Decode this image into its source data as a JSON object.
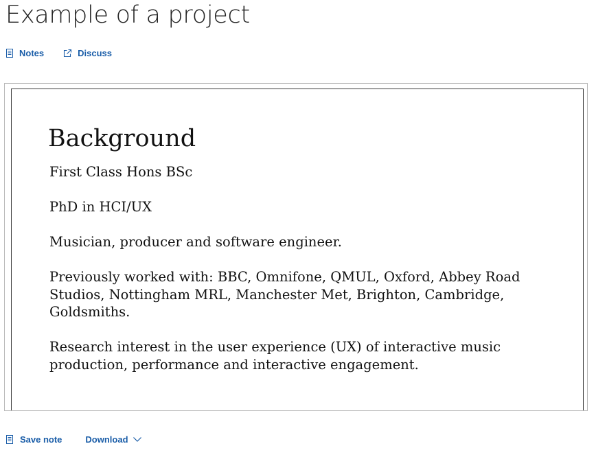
{
  "page": {
    "title": "Example of a project"
  },
  "top_links": {
    "notes_label": "Notes",
    "discuss_label": "Discuss"
  },
  "slide": {
    "heading": "Background",
    "paragraphs": [
      "First Class Hons BSc",
      "PhD in HCI/UX",
      "Musician, producer and software engineer.",
      "Previously worked with: BBC, Omnifone, QMUL, Oxford, Abbey Road Studios, Nottingham MRL, Manchester Met, Brighton, Cambridge, Goldsmiths.",
      "Research interest in the user experience (UX) of interactive music production, performance and interactive engagement."
    ]
  },
  "bottom_bar": {
    "save_note_label": "Save note",
    "download_label": "Download"
  },
  "icons": {
    "notes": "notes-document-icon",
    "discuss": "external-link-icon",
    "save_note": "document-icon",
    "download": "chevron-down-icon"
  },
  "colors": {
    "link": "#1a5da8",
    "title": "#222222"
  }
}
